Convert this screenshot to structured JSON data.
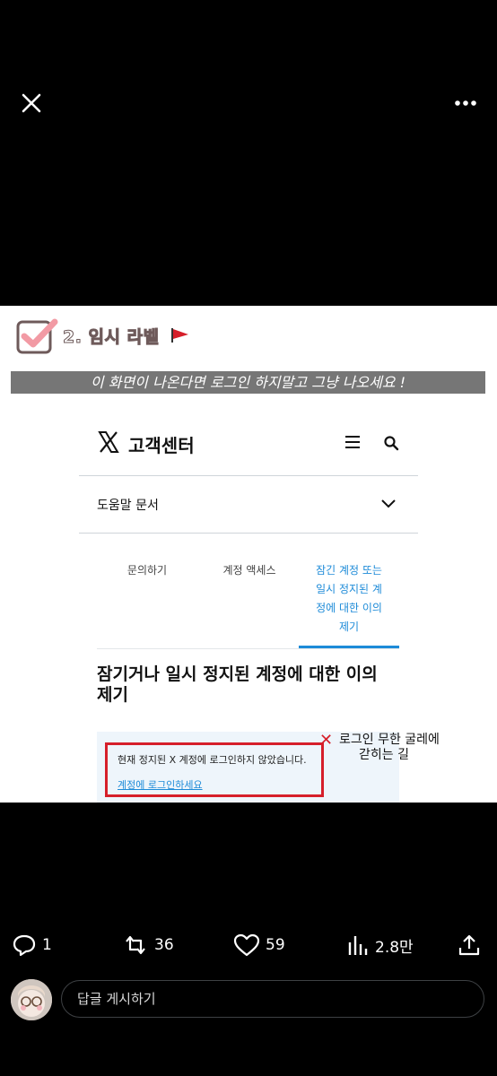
{
  "media": {
    "heading": "2. 임시 라벨",
    "banner": "이 화면이 나온다면 로그인 하지말고 그냥 나오세요 !",
    "help_center": {
      "title": "고객센터",
      "docs_label": "도움말 문서",
      "tabs": [
        {
          "label": "문의하기",
          "active": false
        },
        {
          "label": "계정 액세스",
          "active": false
        },
        {
          "label_lines": [
            "잠긴 계정 또는",
            "일시 정지된 계",
            "정에 대한 이의",
            "제기"
          ],
          "active": true
        }
      ],
      "article_title_lines": [
        "잠기거나 일시 정지된 계정에 대한 이의",
        "제기"
      ],
      "notice_text": "현재 정지된 X 계정에 로그인하지 않았습니다.",
      "notice_link": "계정에 로그인하세요",
      "accent_color": "#1d8bd8"
    },
    "annotation_lines": [
      "로그인 무한 굴레에",
      "갇히는 길"
    ],
    "annotation_color": "#d61f2a"
  },
  "actions": {
    "replies": "1",
    "reposts": "36",
    "likes": "59",
    "views": "2.8만"
  },
  "reply": {
    "placeholder": "답글 게시하기"
  },
  "icons": [
    "close-icon",
    "more-icon",
    "checkbox-check-icon",
    "flag-icon",
    "x-logo-icon",
    "menu-icon",
    "search-icon",
    "chevron-down-icon",
    "reply-icon",
    "repost-icon",
    "like-icon",
    "views-icon",
    "share-icon"
  ]
}
